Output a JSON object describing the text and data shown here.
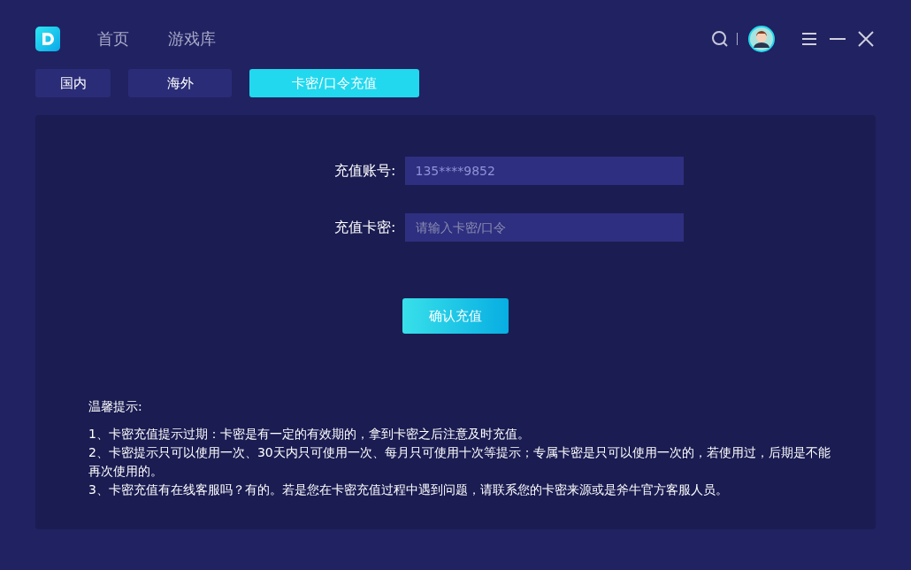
{
  "nav": {
    "items": [
      {
        "label": "首页",
        "selected": false
      },
      {
        "label": "游戏库",
        "selected": false
      }
    ]
  },
  "tabs": [
    {
      "label": "国内",
      "selected": false
    },
    {
      "label": "海外",
      "selected": false
    },
    {
      "label": "卡密/口令充值",
      "selected": true
    }
  ],
  "form": {
    "fields": [
      {
        "label": "充值账号:",
        "value": "135****9852"
      },
      {
        "label": "充值卡密:",
        "placeholder": "请输入卡密/口令"
      }
    ],
    "submit": "确认充值"
  },
  "notes": {
    "title": "温馨提示:",
    "items": [
      "1、卡密充值提示过期：卡密是有一定的有效期的，拿到卡密之后注意及时充值。",
      "2、卡密提示只可以使用一次、30天内只可使用一次、每月只可使用十次等提示；专属卡密是只可以使用一次的，若使用过，后期是不能再次使用的。",
      "3、卡密充值有在线客服吗？有的。若是您在卡密充值过程中遇到问题，请联系您的卡密来源或是斧牛官方客服人员。"
    ]
  }
}
